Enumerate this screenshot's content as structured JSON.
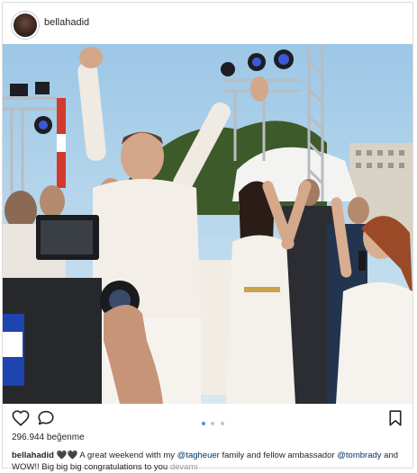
{
  "post": {
    "username": "bellahadid",
    "likes_text": "296.944 beğenme",
    "caption": {
      "username": "bellahadid",
      "emoji": "🖤🖤",
      "text_1": "A great weekend with my",
      "mention_1": "@tagheuer",
      "text_2": "family and fellow ambassador",
      "mention_2": "@tombrady",
      "text_3": "and WOW!! Big big big congratulations to you",
      "more_label": "devamı"
    },
    "carousel": {
      "count": 3,
      "active_index": 0
    }
  },
  "icons": {
    "avatar": "profile-photo",
    "like": "heart-outline-icon",
    "comment": "comment-bubble-icon",
    "save": "bookmark-icon"
  },
  "colors": {
    "link": "#003569",
    "more": "#999999",
    "active_dot": "#3897f0",
    "inactive_dot": "#c4c4c4",
    "border": "#dbdbdb"
  }
}
